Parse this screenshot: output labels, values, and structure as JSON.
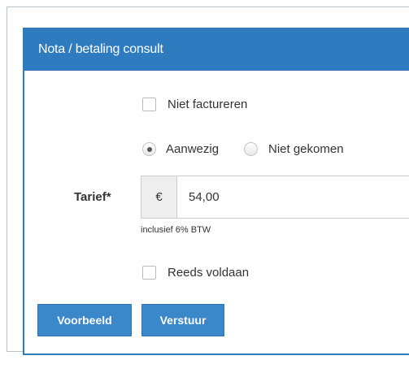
{
  "panel": {
    "title": "Nota / betaling consult"
  },
  "form": {
    "niet_factureren": {
      "label": "Niet factureren",
      "checked": false
    },
    "attendance": {
      "options": [
        {
          "label": "Aanwezig",
          "selected": true
        },
        {
          "label": "Niet gekomen",
          "selected": false
        }
      ]
    },
    "tarief": {
      "label": "Tarief*",
      "currency_symbol": "€",
      "value": "54,00",
      "help": "inclusief 6% BTW"
    },
    "reeds_voldaan": {
      "label": "Reeds voldaan",
      "checked": false
    }
  },
  "actions": {
    "preview_label": "Voorbeeld",
    "send_label": "Verstuur"
  },
  "colors": {
    "header_bg": "#2e7cbf",
    "button_bg": "#3a87c9"
  }
}
